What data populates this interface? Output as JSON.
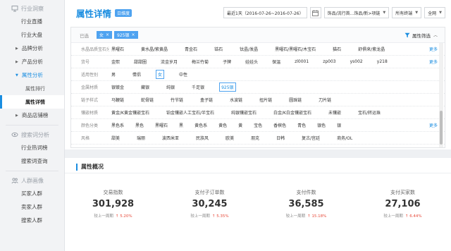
{
  "sidebar": {
    "sections": [
      {
        "title": "行业洞察",
        "icon": "monitor-icon",
        "items": [
          {
            "label": "行业直播",
            "type": "item"
          },
          {
            "label": "行业大盘",
            "type": "item"
          },
          {
            "label": "品牌分析",
            "type": "group"
          },
          {
            "label": "产品分析",
            "type": "group"
          },
          {
            "label": "属性分析",
            "type": "group-open"
          },
          {
            "label": "属性排行",
            "type": "sub"
          },
          {
            "label": "属性详情",
            "type": "sub-active"
          },
          {
            "label": "商品店铺榜",
            "type": "group"
          }
        ]
      },
      {
        "title": "搜索词分析",
        "icon": "eye-icon",
        "items": [
          {
            "label": "行业热词榜",
            "type": "item"
          },
          {
            "label": "搜索词查询",
            "type": "item"
          }
        ]
      },
      {
        "title": "人群画像",
        "icon": "people-icon",
        "items": [
          {
            "label": "买家人群",
            "type": "item"
          },
          {
            "label": "卖家人群",
            "type": "item"
          },
          {
            "label": "搜索人群",
            "type": "item"
          }
        ]
      }
    ]
  },
  "header": {
    "title": "属性详情",
    "badge": "日维度",
    "date_range": "最近1天（2016-07-26~2016-07-26）",
    "category": "饰品/流行首...饰品/新>项链",
    "terminal": "所有终端",
    "scope": "全网"
  },
  "filter": {
    "selected_label": "已选",
    "selected_chips": [
      "女",
      "925银"
    ],
    "attr_filter_label": "属性筛选",
    "rows": [
      {
        "label": "水晶品质宝石分类",
        "options": [
          "黑曜石",
          "黄水晶/紫黄晶",
          "青金石",
          "锆石",
          "钛晶/发晶",
          "黑曜石/黑曜石/木宝石",
          "猫石",
          "舒俱来/紫龙晶"
        ],
        "more": "更多",
        "selected": ""
      },
      {
        "label": "货号",
        "options": [
          "金熙",
          "甜甜圈",
          "流金岁月",
          "梅兰竹菊",
          "子牌",
          "娃娃头",
          "保温",
          "zl0001",
          "zp003",
          "ys002",
          "y218"
        ],
        "more": "更多",
        "selected": ""
      },
      {
        "label": "适用性别",
        "options": [
          "男",
          "情侣",
          "女",
          "中性"
        ],
        "more": "",
        "selected": "女"
      },
      {
        "label": "金属材质",
        "options": [
          "银镀金",
          "藏银",
          "纯银",
          "千足银",
          "925银"
        ],
        "more": "",
        "selected": "925银"
      },
      {
        "label": "链子样式",
        "options": [
          "马鞭链",
          "蛇骨链",
          "竹节链",
          "盒子链",
          "水波链",
          "扭片链",
          "圆珠链",
          "刀片链"
        ],
        "more": "",
        "selected": ""
      },
      {
        "label": "镶嵌材质",
        "options": [
          "黄金/K黄金镶嵌宝石",
          "铂金镶嵌人工宝石/半宝石",
          "纯银镶嵌宝石",
          "白金/K白金镶嵌宝石",
          "未镶嵌",
          "宝石/转运珠"
        ],
        "more": "",
        "selected": ""
      },
      {
        "label": "颜色分类",
        "options": [
          "黑色系",
          "黑色",
          "黑曜石",
          "黑",
          "黄色系",
          "黄色",
          "黄",
          "宝色",
          "香槟色",
          "青色",
          "银色",
          "银"
        ],
        "more": "更多",
        "selected": ""
      },
      {
        "label": "风格",
        "options": [
          "甜美",
          "瑞丽",
          "波西米亚",
          "民族风",
          "欧美",
          "朋克",
          "日韩",
          "复古/宫廷",
          "商务/OL"
        ],
        "more": "",
        "selected": ""
      }
    ]
  },
  "overview": {
    "title": "属性概况",
    "compare_label": "较上一周期",
    "stats": [
      {
        "label": "交易指数",
        "value": "301,928",
        "delta": "5.20%"
      },
      {
        "label": "支付子订单数",
        "value": "30,245",
        "delta": "5.35%"
      },
      {
        "label": "支付件数",
        "value": "36,585",
        "delta": "15.18%"
      },
      {
        "label": "支付买家数",
        "value": "27,106",
        "delta": "6.44%"
      }
    ]
  },
  "colors": {
    "accent": "#1a8de0",
    "chip": "#4fa3f0",
    "delta_up": "#e74c3c"
  }
}
